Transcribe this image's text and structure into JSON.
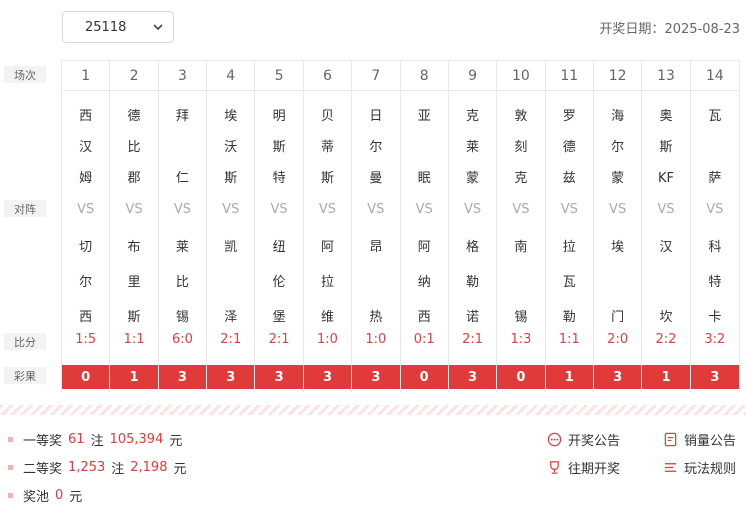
{
  "header": {
    "issue": "25118",
    "date_label": "开奖日期：",
    "date": "2025-08-23"
  },
  "row_labels": {
    "match_no": "场次",
    "teams": "对阵",
    "score": "比分",
    "result": "彩果"
  },
  "vs_text": "VS",
  "matches": [
    {
      "no": "1",
      "home": [
        "西",
        "汉",
        "姆"
      ],
      "away": [
        "切",
        "尔",
        "西"
      ],
      "score": "1:5",
      "result": "0"
    },
    {
      "no": "2",
      "home": [
        "德",
        "比",
        "郡"
      ],
      "away": [
        "布",
        "里",
        "斯"
      ],
      "score": "1:1",
      "result": "1"
    },
    {
      "no": "3",
      "home": [
        "拜",
        "",
        "仁"
      ],
      "away": [
        "莱",
        "比",
        "锡"
      ],
      "score": "6:0",
      "result": "3"
    },
    {
      "no": "4",
      "home": [
        "埃",
        "沃",
        "斯"
      ],
      "away": [
        "凯",
        "",
        "泽"
      ],
      "score": "2:1",
      "result": "3"
    },
    {
      "no": "5",
      "home": [
        "明",
        "斯",
        "特"
      ],
      "away": [
        "纽",
        "伦",
        "堡"
      ],
      "score": "2:1",
      "result": "3"
    },
    {
      "no": "6",
      "home": [
        "贝",
        "蒂",
        "斯"
      ],
      "away": [
        "阿",
        "拉",
        "维"
      ],
      "score": "1:0",
      "result": "3"
    },
    {
      "no": "7",
      "home": [
        "日",
        "尔",
        "曼"
      ],
      "away": [
        "昂",
        "",
        "热"
      ],
      "score": "1:0",
      "result": "3"
    },
    {
      "no": "8",
      "home": [
        "亚",
        "",
        "眠"
      ],
      "away": [
        "阿",
        "纳",
        "西"
      ],
      "score": "0:1",
      "result": "0"
    },
    {
      "no": "9",
      "home": [
        "克",
        "莱",
        "蒙"
      ],
      "away": [
        "格",
        "勒",
        "诺"
      ],
      "score": "2:1",
      "result": "3"
    },
    {
      "no": "10",
      "home": [
        "敦",
        "刻",
        "克"
      ],
      "away": [
        "南",
        "",
        "锡"
      ],
      "score": "1:3",
      "result": "0"
    },
    {
      "no": "11",
      "home": [
        "罗",
        "德",
        "兹"
      ],
      "away": [
        "拉",
        "瓦",
        "勒"
      ],
      "score": "1:1",
      "result": "1"
    },
    {
      "no": "12",
      "home": [
        "海",
        "尔",
        "蒙"
      ],
      "away": [
        "埃",
        "",
        "门"
      ],
      "score": "2:0",
      "result": "3"
    },
    {
      "no": "13",
      "home": [
        "奥",
        "斯",
        "KF"
      ],
      "away": [
        "汉",
        "",
        "坎"
      ],
      "score": "2:2",
      "result": "1"
    },
    {
      "no": "14",
      "home": [
        "瓦",
        "",
        "萨"
      ],
      "away": [
        "科",
        "特",
        "卡"
      ],
      "score": "3:2",
      "result": "3"
    }
  ],
  "prizes": {
    "first": {
      "label": "一等奖",
      "count": "61",
      "unit": "注",
      "amount": "105,394",
      "currency": "元"
    },
    "second": {
      "label": "二等奖",
      "count": "1,253",
      "unit": "注",
      "amount": "2,198",
      "currency": "元"
    },
    "pool": {
      "label": "奖池",
      "amount": "0",
      "currency": "元"
    }
  },
  "links": {
    "announcement": "开奖公告",
    "sales": "销量公告",
    "history": "往期开奖",
    "rules": "玩法规则"
  },
  "colors": {
    "accent": "#e03a3a"
  }
}
